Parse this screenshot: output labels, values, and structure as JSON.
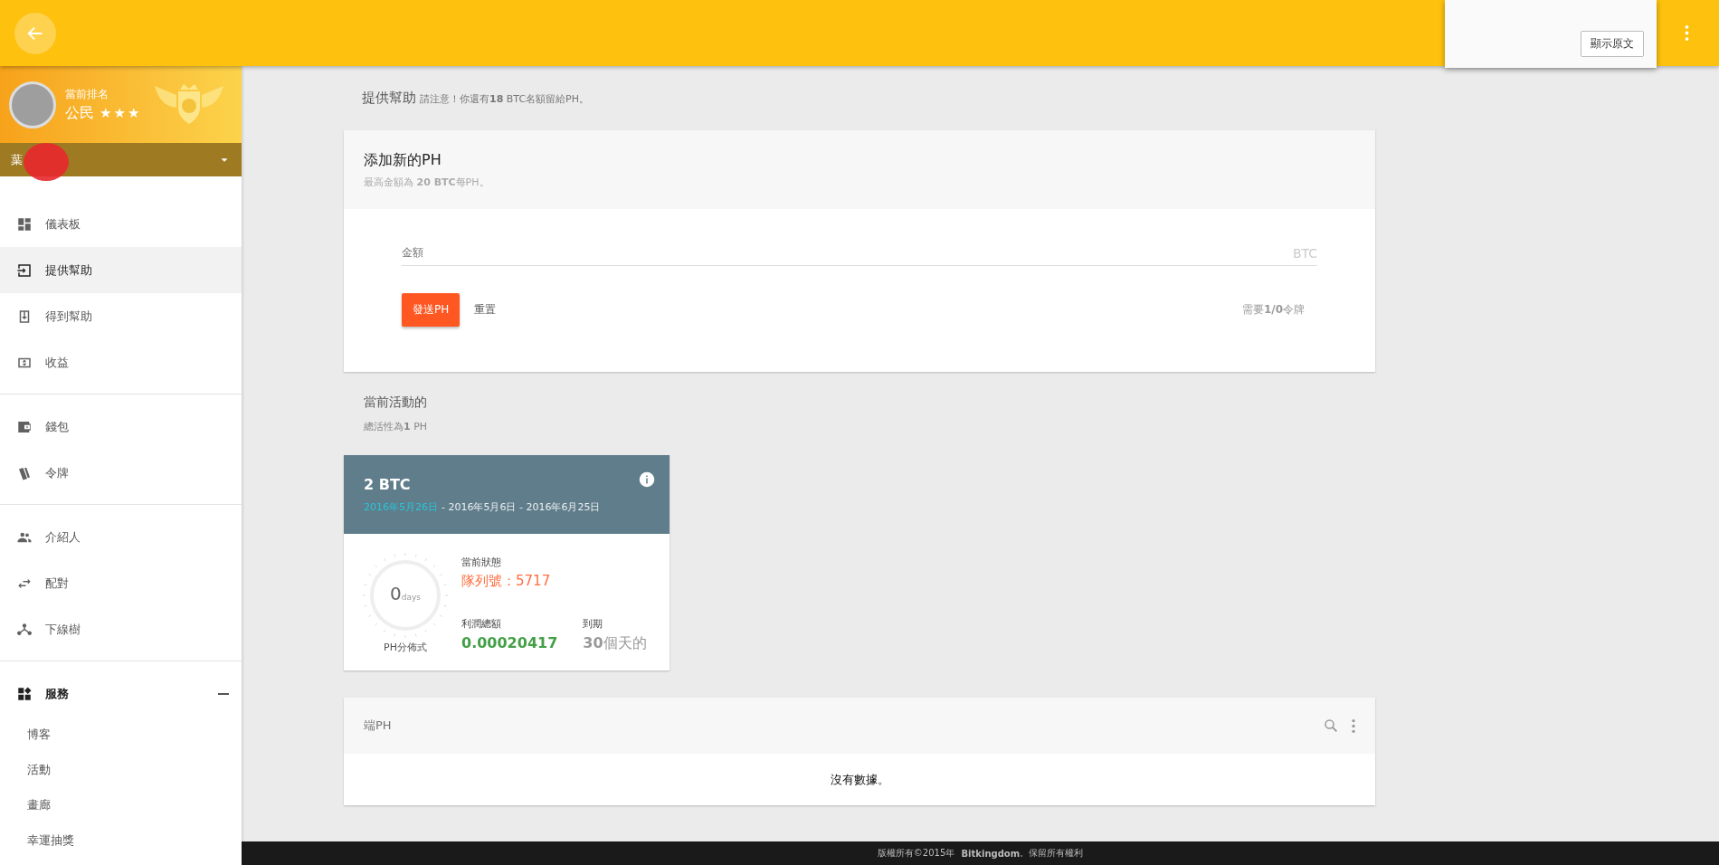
{
  "translate_popup": {
    "button": "顯示原文"
  },
  "profile": {
    "rank_label": "當前排名",
    "rank": "公民",
    "stars": 3,
    "username": "葉"
  },
  "sidebar": {
    "groups": [
      {
        "items": [
          {
            "label": "儀表板",
            "selected": false
          },
          {
            "label": "提供幫助",
            "selected": true
          },
          {
            "label": "得到幫助",
            "selected": false
          },
          {
            "label": "收益",
            "selected": false
          }
        ]
      },
      {
        "items": [
          {
            "label": "錢包",
            "selected": false
          },
          {
            "label": "令牌",
            "selected": false
          }
        ]
      },
      {
        "items": [
          {
            "label": "介紹人",
            "selected": false
          },
          {
            "label": "配對",
            "selected": false
          },
          {
            "label": "下線樹",
            "selected": false
          }
        ]
      }
    ],
    "services": {
      "label": "服務",
      "expanded": true,
      "children": [
        {
          "label": "博客"
        },
        {
          "label": "活動"
        },
        {
          "label": "畫廊"
        },
        {
          "label": "幸運抽獎"
        }
      ]
    }
  },
  "page": {
    "title": "提供幫助",
    "notice": "請注意！你還有**18** BTC名額留給PH。"
  },
  "new_ph": {
    "title": "添加新的PH",
    "subtitle": "最高金額為 **20 BTC**每PH。",
    "amount_label": "金額",
    "amount_suffix": "BTC",
    "submit": "發送PH",
    "reset": "重置",
    "tokens_note": "需要**1/0**令牌"
  },
  "active": {
    "title": "當前活動的",
    "subtitle": "總活性為**1** PH"
  },
  "ph_cards": [
    {
      "amount": "2 BTC",
      "start_date": "2016年5月26日",
      "date_range": "- 2016年5月6日 - 2016年6月25日",
      "days": "0",
      "days_unit": "days",
      "gauge_label": "PH分佈式",
      "status_label": "當前狀態",
      "status": "隊列號：5717",
      "profit_label": "利潤總額",
      "profit": "0.00020417",
      "due_label": "到期",
      "due": "**30**個天的"
    }
  ],
  "ph_table": {
    "title": "端PH",
    "empty": "沒有數據。"
  },
  "footer": "版權所有©2015年 **Bitkingdom**。保留所有權利"
}
